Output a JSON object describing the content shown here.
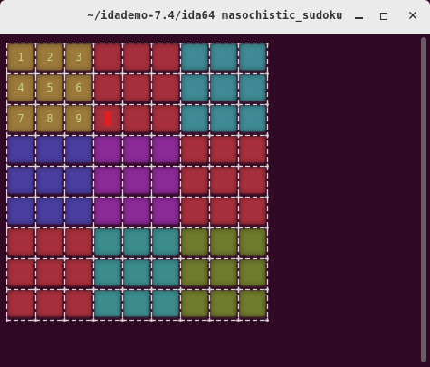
{
  "window": {
    "title": "~/idademo-7.4/ida64 masochistic_sudoku",
    "buttons": [
      {
        "name": "minimize-button",
        "icon": "minimize-icon"
      },
      {
        "name": "maximize-button",
        "icon": "maximize-icon"
      },
      {
        "name": "close-button",
        "icon": "close-icon",
        "glyph": "✕"
      }
    ]
  },
  "board": {
    "rows": 9,
    "cols": 9,
    "grid_chars": {
      "corner": "+",
      "horizontal": "-",
      "vertical": "|"
    },
    "colors": {
      "tan": "#9c7a3c",
      "red": "#a8303c",
      "teal": "#3f8a94",
      "blue": "#4a3ea0",
      "purple": "#8c2a98",
      "cyan": "#3c8c8e",
      "olive": "#6e7a2c",
      "grid_line": "#d8d8d8",
      "number": "#c8d27a",
      "cursor": "#e02020"
    },
    "region_colors": [
      [
        "tan",
        "tan",
        "tan",
        "red",
        "red",
        "red",
        "teal",
        "teal",
        "teal"
      ],
      [
        "tan",
        "tan",
        "tan",
        "red",
        "red",
        "red",
        "teal",
        "teal",
        "teal"
      ],
      [
        "tan",
        "tan",
        "tan",
        "red",
        "red",
        "red",
        "teal",
        "teal",
        "teal"
      ],
      [
        "blue",
        "blue",
        "blue",
        "purple",
        "purple",
        "purple",
        "red",
        "red",
        "red"
      ],
      [
        "blue",
        "blue",
        "blue",
        "purple",
        "purple",
        "purple",
        "red",
        "red",
        "red"
      ],
      [
        "blue",
        "blue",
        "blue",
        "purple",
        "purple",
        "purple",
        "red",
        "red",
        "red"
      ],
      [
        "red",
        "red",
        "red",
        "cyan",
        "cyan",
        "cyan",
        "olive",
        "olive",
        "olive"
      ],
      [
        "red",
        "red",
        "red",
        "cyan",
        "cyan",
        "cyan",
        "olive",
        "olive",
        "olive"
      ],
      [
        "red",
        "red",
        "red",
        "cyan",
        "cyan",
        "cyan",
        "olive",
        "olive",
        "olive"
      ]
    ],
    "values": [
      [
        "1",
        "2",
        "3",
        "",
        "",
        "",
        "",
        "",
        ""
      ],
      [
        "4",
        "5",
        "6",
        "",
        "",
        "",
        "",
        "",
        ""
      ],
      [
        "7",
        "8",
        "9",
        "",
        "",
        "",
        "",
        "",
        ""
      ],
      [
        "",
        "",
        "",
        "",
        "",
        "",
        "",
        "",
        ""
      ],
      [
        "",
        "",
        "",
        "",
        "",
        "",
        "",
        "",
        ""
      ],
      [
        "",
        "",
        "",
        "",
        "",
        "",
        "",
        "",
        ""
      ],
      [
        "",
        "",
        "",
        "",
        "",
        "",
        "",
        "",
        ""
      ],
      [
        "",
        "",
        "",
        "",
        "",
        "",
        "",
        "",
        ""
      ],
      [
        "",
        "",
        "",
        "",
        "",
        "",
        "",
        "",
        ""
      ]
    ],
    "cursor": {
      "row": 2,
      "col": 3
    }
  }
}
